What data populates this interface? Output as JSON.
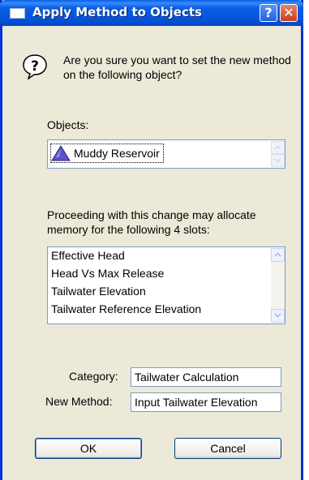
{
  "window": {
    "title": "Apply Method to Objects",
    "help_glyph": "?",
    "close_glyph": "✕"
  },
  "prompt": {
    "icon": "question-icon",
    "text": "Are you sure you want to set the new method on the following object?"
  },
  "objects": {
    "label": "Objects:",
    "items": [
      {
        "name": "Muddy Reservoir",
        "icon": "reservoir-triangle-icon",
        "icon_color": "#5b52c9"
      }
    ]
  },
  "slots": {
    "explanation": "Proceeding with this change may allocate memory for the following 4 slots:",
    "items": [
      "Effective Head",
      "Head Vs Max Release",
      "Tailwater Elevation",
      "Tailwater Reference Elevation"
    ]
  },
  "category": {
    "label": "Category:",
    "value": "Tailwater Calculation"
  },
  "new_method": {
    "label": "New Method:",
    "value": "Input Tailwater Elevation"
  },
  "buttons": {
    "ok": "OK",
    "cancel": "Cancel"
  },
  "colors": {
    "titlebar": "#0454dc",
    "dialog_bg": "#ece9d8",
    "field_border": "#7f9db9"
  }
}
